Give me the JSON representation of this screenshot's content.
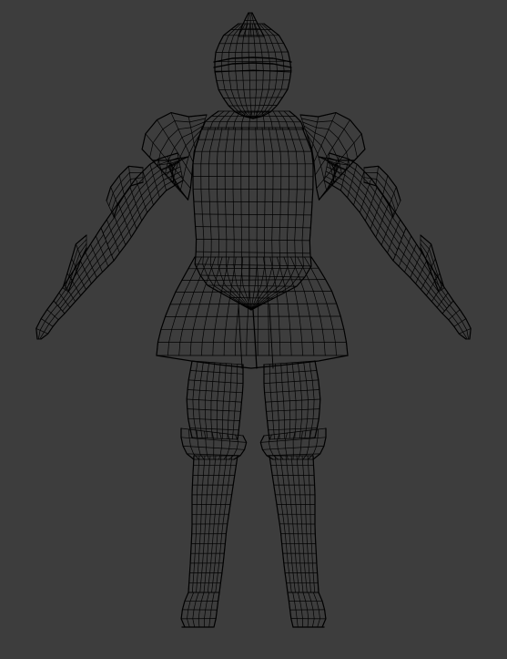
{
  "viewport": {
    "background": "#3d3d3d",
    "wire_color": "#000000",
    "shading_mode": "wireframe",
    "subject": "armored-knight-mesh"
  }
}
